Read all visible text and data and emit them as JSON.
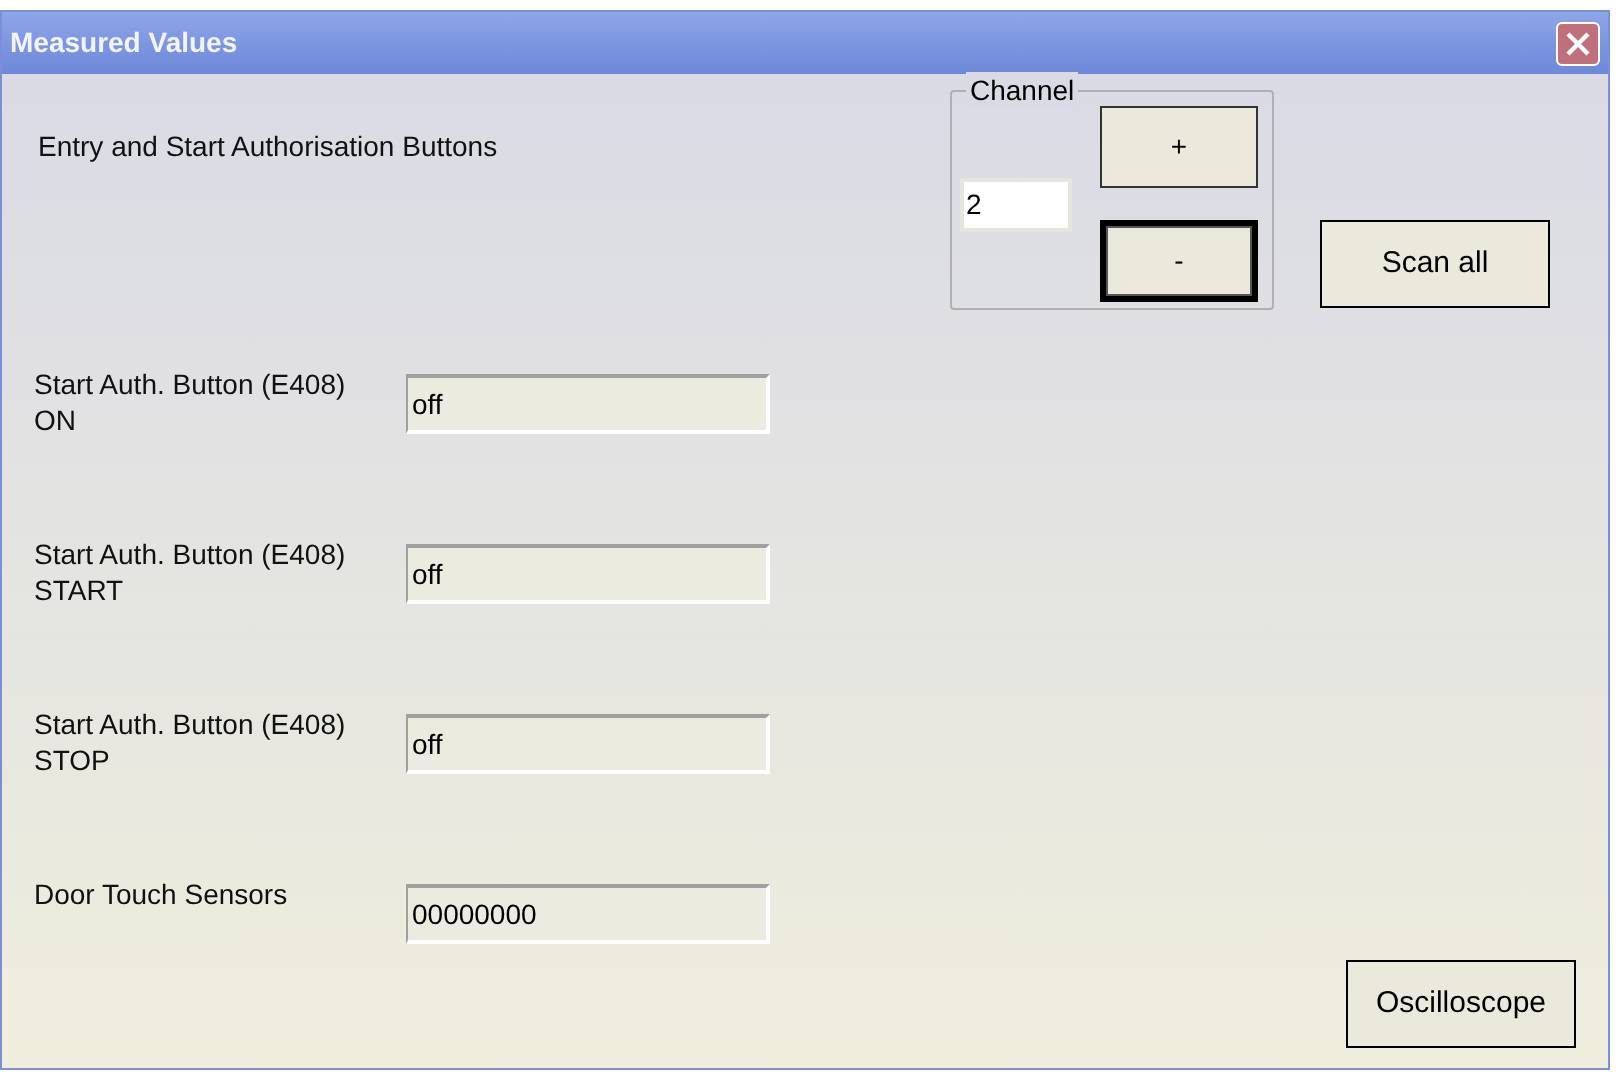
{
  "window": {
    "title": "Measured Values"
  },
  "heading": "Entry and Start Authorisation Buttons",
  "channel": {
    "label": "Channel",
    "value": "2",
    "buttons": [
      {
        "label": "+",
        "focused": false
      },
      {
        "label": "-",
        "focused": true
      }
    ]
  },
  "scan_button": "Scan all",
  "rows": [
    {
      "label": "Start Auth. Button (E408)\nON",
      "value": "off"
    },
    {
      "label": "Start Auth. Button (E408)\nSTART",
      "value": "off"
    },
    {
      "label": "Start Auth. Button (E408)\nSTOP",
      "value": "off"
    },
    {
      "label": "Door Touch Sensors",
      "value": "00000000"
    }
  ],
  "oscilloscope_button": "Oscilloscope"
}
